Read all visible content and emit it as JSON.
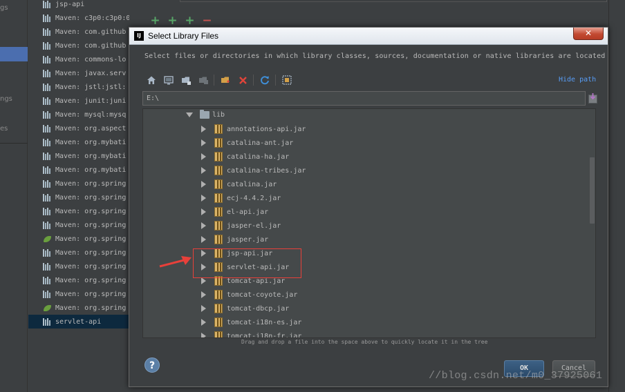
{
  "settings_strip": {
    "stubs": [
      "gs",
      "ngs",
      "es"
    ]
  },
  "libraries": [
    {
      "label": "jsp-api",
      "icon": "library-icon"
    },
    {
      "label": "Maven: c3p0:c3p0:0.9.",
      "icon": "library-icon"
    },
    {
      "label": "Maven: com.github",
      "icon": "library-icon"
    },
    {
      "label": "Maven: com.github",
      "icon": "library-icon"
    },
    {
      "label": "Maven: commons-lo",
      "icon": "library-icon"
    },
    {
      "label": "Maven: javax.serv",
      "icon": "library-icon"
    },
    {
      "label": "Maven: jstl:jstl:",
      "icon": "library-icon"
    },
    {
      "label": "Maven: junit:juni",
      "icon": "library-icon"
    },
    {
      "label": "Maven: mysql:mysq",
      "icon": "library-icon"
    },
    {
      "label": "Maven: org.aspect",
      "icon": "library-icon"
    },
    {
      "label": "Maven: org.mybati",
      "icon": "library-icon"
    },
    {
      "label": "Maven: org.mybati",
      "icon": "library-icon"
    },
    {
      "label": "Maven: org.mybati",
      "icon": "library-icon"
    },
    {
      "label": "Maven: org.spring",
      "icon": "library-icon"
    },
    {
      "label": "Maven: org.spring",
      "icon": "library-icon"
    },
    {
      "label": "Maven: org.spring",
      "icon": "library-icon"
    },
    {
      "label": "Maven: org.spring",
      "icon": "library-icon"
    },
    {
      "label": "Maven: org.spring",
      "icon": "spring-leaf-icon"
    },
    {
      "label": "Maven: org.spring",
      "icon": "library-icon"
    },
    {
      "label": "Maven: org.spring",
      "icon": "library-icon"
    },
    {
      "label": "Maven: org.spring",
      "icon": "library-icon"
    },
    {
      "label": "Maven: org.spring",
      "icon": "library-icon"
    },
    {
      "label": "Maven: org.spring",
      "icon": "spring-leaf-icon"
    },
    {
      "label": "servlet-api",
      "icon": "library-icon",
      "selected": true
    }
  ],
  "top_toolbar": {
    "buttons": [
      "+",
      "+",
      "+",
      "−"
    ]
  },
  "dialog": {
    "title": "Select Library Files",
    "app_icon": "IJ",
    "close_label": "✕",
    "description": "Select files or directories in which library classes, sources, documentation or native libraries are located",
    "toolbar_icons": [
      "home-icon",
      "desktop-icon",
      "new-folder-icon",
      "project-icon",
      "new-folder-alt-icon",
      "delete-icon",
      "refresh-icon",
      "show-hidden-icon"
    ],
    "hide_path_label": "Hide path",
    "path_value": "E:\\",
    "tree": {
      "folder": "lib",
      "items": [
        "annotations-api.jar",
        "catalina-ant.jar",
        "catalina-ha.jar",
        "catalina-tribes.jar",
        "catalina.jar",
        "ecj-4.4.2.jar",
        "el-api.jar",
        "jasper-el.jar",
        "jasper.jar",
        "jsp-api.jar",
        "servlet-api.jar",
        "tomcat-api.jar",
        "tomcat-coyote.jar",
        "tomcat-dbcp.jar",
        "tomcat-i18n-es.jar",
        "tomcat-i18n-fr.jar"
      ]
    },
    "drag_hint": "Drag and drop a file into the space above to quickly locate it in the tree",
    "help_label": "?",
    "ok_label": "OK",
    "cancel_label": "Cancel"
  },
  "colors": {
    "accent": "#4b6eaf",
    "highlight": "#e8403a",
    "link": "#589df6"
  },
  "watermark": "//blog.csdn.net/m0_37925061"
}
